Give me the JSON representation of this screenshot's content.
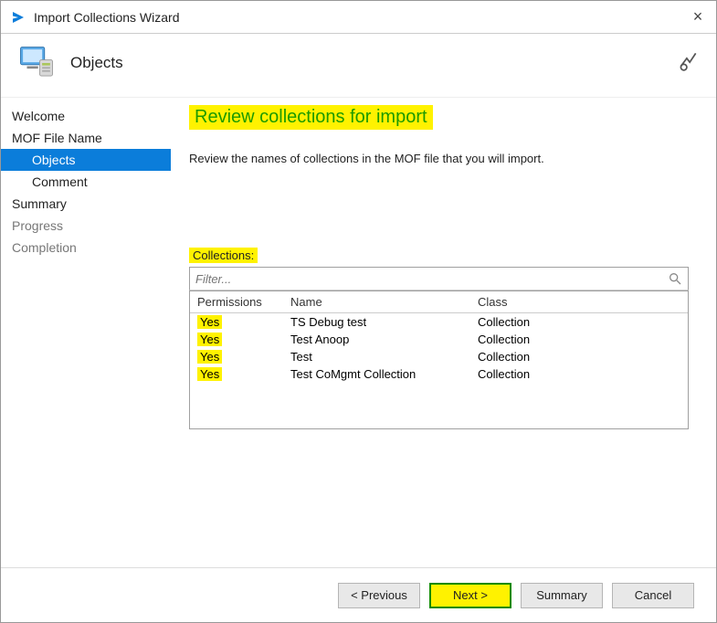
{
  "window": {
    "title": "Import Collections Wizard",
    "close_label": "×"
  },
  "header": {
    "page_title": "Objects"
  },
  "sidebar": {
    "items": [
      {
        "label": "Welcome",
        "selected": false,
        "sub": false,
        "disabled": false
      },
      {
        "label": "MOF File Name",
        "selected": false,
        "sub": false,
        "disabled": false
      },
      {
        "label": "Objects",
        "selected": true,
        "sub": true,
        "disabled": false
      },
      {
        "label": "Comment",
        "selected": false,
        "sub": true,
        "disabled": false
      },
      {
        "label": "Summary",
        "selected": false,
        "sub": false,
        "disabled": false
      },
      {
        "label": "Progress",
        "selected": false,
        "sub": false,
        "disabled": true
      },
      {
        "label": "Completion",
        "selected": false,
        "sub": false,
        "disabled": true
      }
    ]
  },
  "main": {
    "heading": "Review collections for import",
    "instructions": "Review the names of collections in the MOF file that you will import.",
    "collections_label": "Collections:",
    "filter_placeholder": "Filter...",
    "columns": {
      "permissions": "Permissions",
      "name": "Name",
      "class": "Class"
    },
    "rows": [
      {
        "permissions": "Yes",
        "name": "TS Debug test",
        "class": "Collection"
      },
      {
        "permissions": "Yes",
        "name": "Test Anoop",
        "class": "Collection"
      },
      {
        "permissions": "Yes",
        "name": "Test",
        "class": "Collection"
      },
      {
        "permissions": "Yes",
        "name": "Test CoMgmt Collection",
        "class": "Collection"
      }
    ]
  },
  "footer": {
    "previous": "< Previous",
    "next": "Next >",
    "summary": "Summary",
    "cancel": "Cancel"
  }
}
